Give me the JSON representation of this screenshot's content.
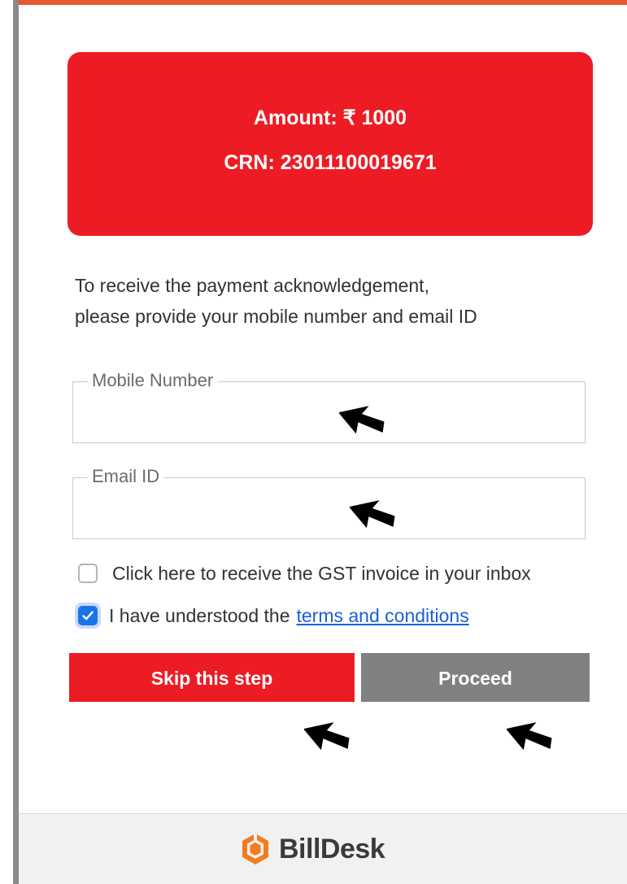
{
  "payment": {
    "amount_label": "Amount: ₹ 1000",
    "crn_label": "CRN: 23011100019671"
  },
  "info": {
    "line1": "To receive the payment acknowledgement,",
    "line2": "please provide your mobile number and email ID"
  },
  "form": {
    "mobile_label": "Mobile Number",
    "mobile_value": "",
    "email_label": "Email ID",
    "email_value": "",
    "gst_checkbox_label": "Click here to receive the GST invoice in your inbox",
    "gst_checked": false,
    "terms_prefix": "I have understood the",
    "terms_link": "terms and conditions",
    "terms_checked": true
  },
  "buttons": {
    "skip_label": "Skip this step",
    "proceed_label": "Proceed"
  },
  "footer": {
    "brand_name": "BillDesk",
    "brand_icon": "billdesk-logo-icon"
  },
  "colors": {
    "primary_red": "#ed1c24",
    "proceed_gray": "#808080",
    "link_blue": "#1a5fd9",
    "checkbox_blue": "#1a73e8",
    "top_accent": "#e8572d",
    "logo_orange": "#f47b20"
  },
  "cursors": {
    "icon": "mouse-pointer-icon"
  }
}
